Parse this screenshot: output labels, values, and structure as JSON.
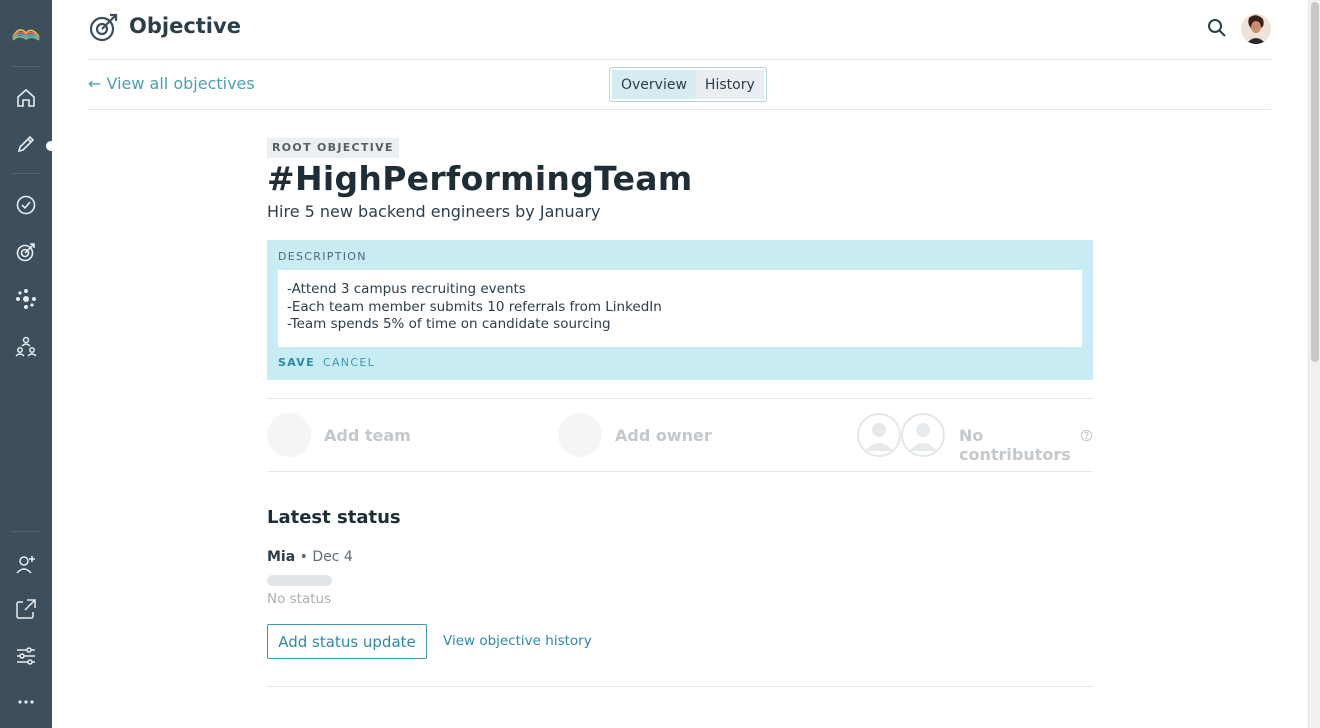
{
  "sidebar": {
    "items": [
      {
        "name": "home"
      },
      {
        "name": "edit"
      },
      {
        "name": "check"
      },
      {
        "name": "objectives"
      },
      {
        "name": "network"
      },
      {
        "name": "org-chart"
      },
      {
        "name": "add-user"
      },
      {
        "name": "share"
      },
      {
        "name": "settings"
      },
      {
        "name": "more"
      }
    ]
  },
  "header": {
    "title": "Objective"
  },
  "subnav": {
    "back_link": "← View all objectives",
    "tabs": [
      {
        "label": "Overview",
        "active": true
      },
      {
        "label": "History",
        "active": false
      }
    ]
  },
  "objective": {
    "tag": "ROOT OBJECTIVE",
    "title": "#HighPerformingTeam",
    "subtitle": "Hire 5 new backend engineers by January"
  },
  "description": {
    "label": "DESCRIPTION",
    "value": "-Attend 3 campus recruiting events\n-Each team member submits 10 referrals from LinkedIn\n-Team spends 5% of time on candidate sourcing",
    "save_label": "SAVE",
    "cancel_label": "CANCEL"
  },
  "people": {
    "team_label": "Add team",
    "owner_label": "Add owner",
    "contributors_label": "No contributors"
  },
  "status": {
    "heading": "Latest status",
    "author": "Mia",
    "separator": "•",
    "date": "Dec 4",
    "text": "No status",
    "add_button": "Add status update",
    "history_link": "View objective history"
  },
  "colors": {
    "sidebar_bg": "#3d4f5c",
    "accent": "#2d8aa4",
    "description_bg": "#c8ecf4"
  }
}
